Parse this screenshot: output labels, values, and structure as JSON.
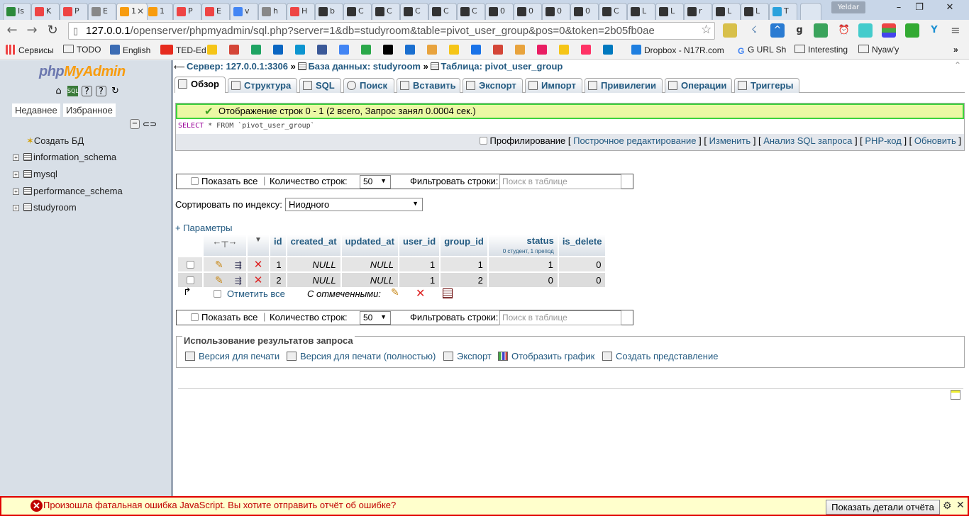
{
  "browser": {
    "tabs": [
      "Is",
      "K",
      "P",
      "E",
      "1",
      "1",
      "P",
      "E",
      "v",
      "h",
      "H",
      "b",
      "C",
      "C",
      "C",
      "C",
      "C",
      "0",
      "0",
      "0",
      "0",
      "C",
      "L",
      "L",
      "r",
      "L",
      "L",
      "T"
    ],
    "active_tab_index": 4,
    "profile": "Yeldar",
    "address_host": "127.0.0.1",
    "address_rest": "/openserver/phpmyadmin/sql.php?server=1&db=studyroom&table=pivot_user_group&pos=0&token=2b05fb0ae",
    "bookmarks": [
      "Сервисы",
      "TODO",
      "English",
      "TED-Ed",
      "",
      "",
      "",
      "",
      "",
      "",
      "",
      "",
      "",
      "",
      "",
      "",
      "",
      "",
      "",
      "",
      "",
      "",
      "",
      "Dropbox - N17R.com",
      "G URL Sh",
      "Interesting",
      "Nyaw'y"
    ],
    "more": "»",
    "accent_color": "#4285f4"
  },
  "left": {
    "logo_php": "php",
    "logo_myadmin": "MyAdmin",
    "recent": "Недавнее",
    "favorites": "Избранное",
    "create_db": "Создать БД",
    "databases": [
      "information_schema",
      "mysql",
      "performance_schema",
      "studyroom"
    ]
  },
  "breadcrumb": {
    "server": "Сервер: 127.0.0.1:3306",
    "database": "База данных: studyroom",
    "table": "Таблица: pivot_user_group"
  },
  "tabs": [
    "Обзор",
    "Структура",
    "SQL",
    "Поиск",
    "Вставить",
    "Экспорт",
    "Импорт",
    "Привилегии",
    "Операции",
    "Триггеры"
  ],
  "success_message": "Отображение строк 0 - 1 (2 всего, Запрос занял 0.0004 сек.)",
  "sql": {
    "keyword": "SELECT",
    "rest": " * FROM `pivot_user_group`",
    "profiling": "Профилирование",
    "links": [
      "Построчное редактирование",
      "Изменить",
      "Анализ SQL запроса",
      "PHP-код",
      "Обновить"
    ]
  },
  "nav": {
    "show_all": "Показать все",
    "row_count_label": "Количество строк:",
    "row_count_value": "50",
    "filter_label": "Фильтровать строки:",
    "filter_placeholder": "Поиск в таблице"
  },
  "sort_label": "Сортировать по индексу:",
  "sort_value": "Ниодного",
  "params_link": "+ Параметры",
  "table": {
    "columns": [
      "id",
      "created_at",
      "updated_at",
      "user_id",
      "group_id",
      "status",
      "is_delete"
    ],
    "status_comment": "0 студент, 1 препод",
    "rows": [
      [
        "1",
        "NULL",
        "NULL",
        "1",
        "1",
        "1",
        "0"
      ],
      [
        "2",
        "NULL",
        "NULL",
        "1",
        "2",
        "0",
        "0"
      ]
    ]
  },
  "check_all": "Отметить все",
  "with_selected": "С отмеченными:",
  "results_ops": {
    "legend": "Использование результатов запроса",
    "items": [
      "Версия для печати",
      "Версия для печати (полностью)",
      "Экспорт",
      "Отобразить график",
      "Создать представление"
    ]
  },
  "error_bar": {
    "message": "Произошла фатальная ошибка JavaScript. Вы хотите отправить отчёт об ошибке?",
    "button": "Показать детали отчёта"
  }
}
